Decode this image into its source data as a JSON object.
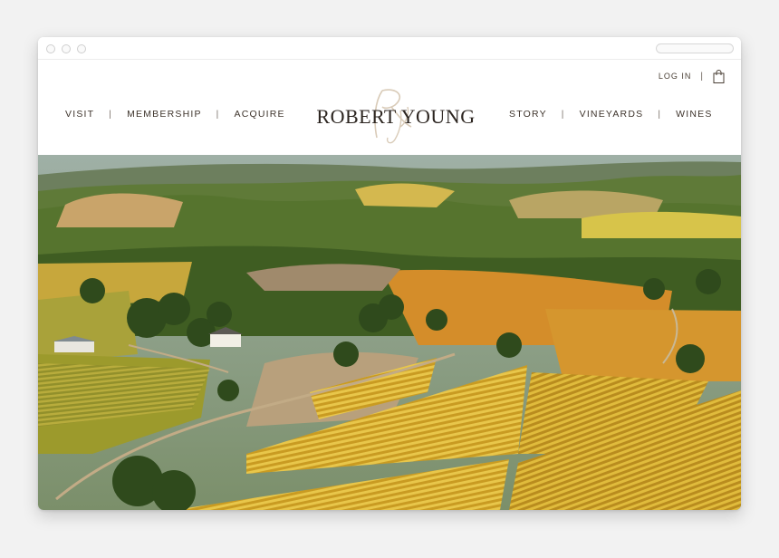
{
  "utility": {
    "login_label": "LOG IN",
    "separator": "|",
    "cart_icon": "shopping-bag-icon"
  },
  "nav_left": [
    {
      "label": "VISIT"
    },
    {
      "label": "MEMBERSHIP"
    },
    {
      "label": "ACQUIRE"
    }
  ],
  "nav_right": [
    {
      "label": "STORY"
    },
    {
      "label": "VINEYARDS"
    },
    {
      "label": "WINES"
    }
  ],
  "nav_separator": "|",
  "brand": {
    "name": "ROBERT YOUNG",
    "monogram_icon": "ry-monogram-icon"
  },
  "colors": {
    "text": "#3e342c",
    "monogram": "#d9cbb8",
    "vine_gold": "#d9b23a",
    "hills": "#6f8a3a"
  }
}
